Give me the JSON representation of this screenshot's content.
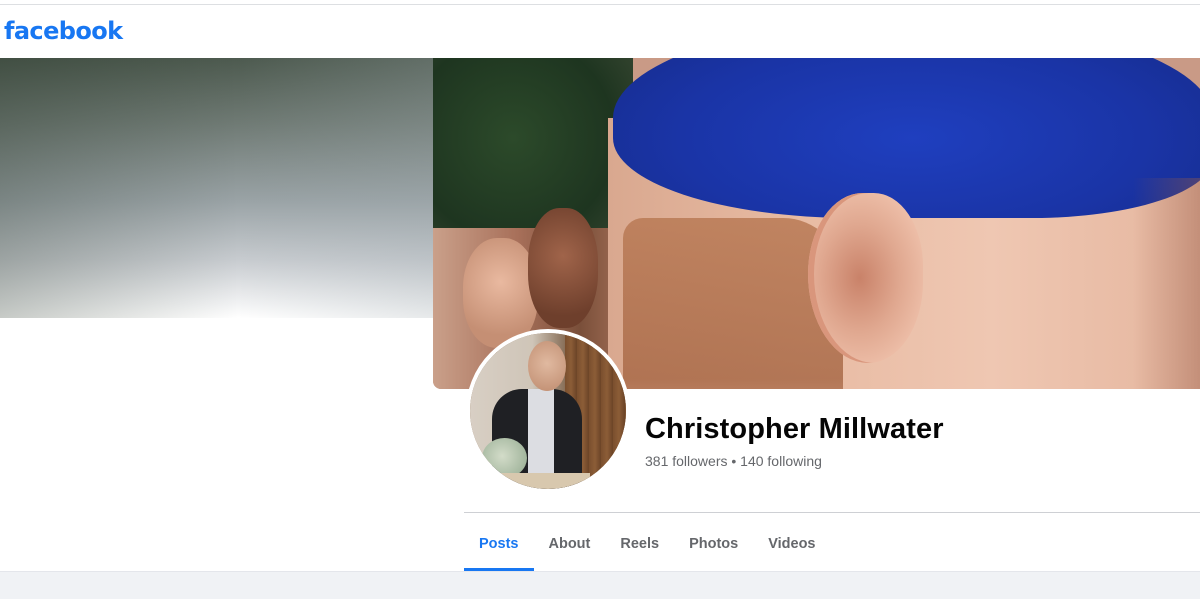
{
  "header": {
    "logo_text": "facebook",
    "brand_color": "#1877f2"
  },
  "profile": {
    "name": "Christopher Millwater",
    "stats": "381 followers • 140 following"
  },
  "tabs": [
    {
      "label": "Posts",
      "active": true
    },
    {
      "label": "About",
      "active": false
    },
    {
      "label": "Reels",
      "active": false
    },
    {
      "label": "Photos",
      "active": false
    },
    {
      "label": "Videos",
      "active": false
    }
  ],
  "colors": {
    "accent": "#1877f2",
    "text_primary": "#050505",
    "text_secondary": "#65676b",
    "page_background": "#f0f2f5"
  }
}
